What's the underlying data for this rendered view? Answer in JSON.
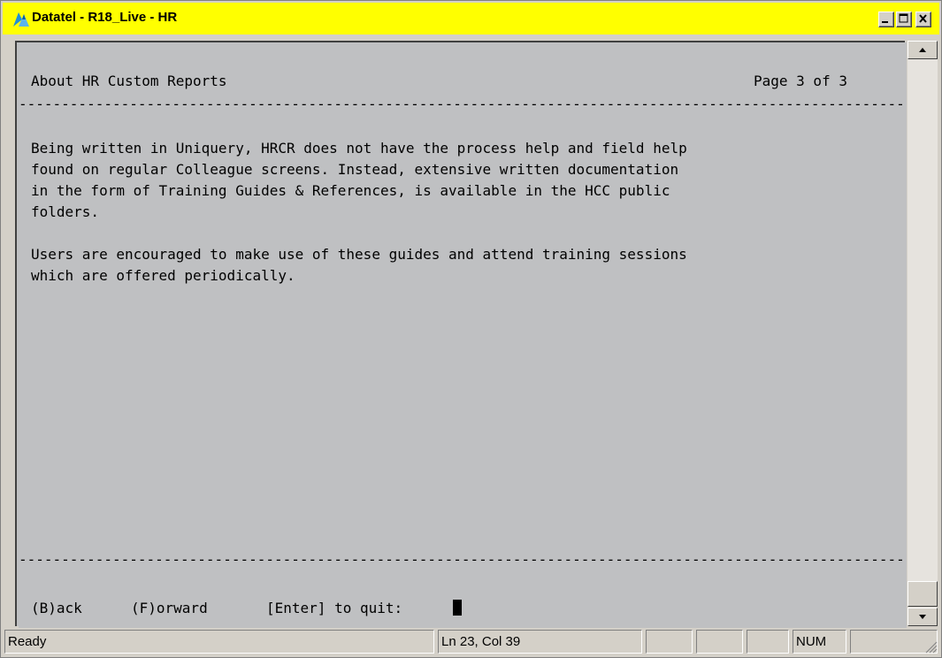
{
  "window": {
    "title": "Datatel - R18_Live - HR",
    "controls": [
      "minimize-icon",
      "maximize-icon",
      "close-icon"
    ]
  },
  "terminal": {
    "header_title": "About HR Custom Reports",
    "page_info": "Page 3 of 3",
    "rule": "--------------------------------------------------------------------------------------------------------",
    "paragraph1": [
      "Being written in Uniquery, HRCR does not have the process help and field help",
      "found on regular Colleague screens. Instead, extensive written documentation",
      "in the form of Training Guides & References, is available in the HCC public",
      "folders."
    ],
    "paragraph2": [
      "Users are encouraged to make use of these guides and attend training sessions",
      "which are offered periodically."
    ],
    "prompt": {
      "back": "(B)ack",
      "forward": "(F)orward",
      "quit": "[Enter] to quit:"
    }
  },
  "statusbar": {
    "status": "Ready",
    "position": "Ln 23, Col 39",
    "panel3": "",
    "panel4": "",
    "panel5": "",
    "num": "NUM",
    "panel7": ""
  },
  "colors": {
    "titlebar": "#ffff00",
    "terminal_bg": "#bfc0c2",
    "chrome": "#d4d0c8"
  }
}
